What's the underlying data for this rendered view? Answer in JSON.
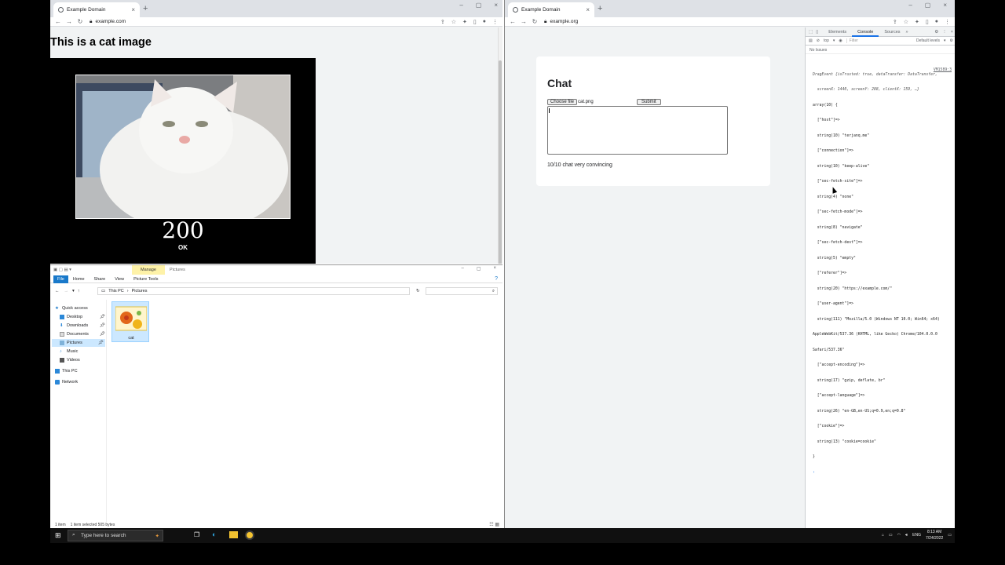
{
  "left_browser": {
    "tab_title": "Example Domain",
    "url": "example.com",
    "page_heading": "This is a cat image",
    "status_code": "200",
    "status_text": "OK"
  },
  "explorer": {
    "manage_label": "Manage",
    "folder_title": "Pictures",
    "ribbon": [
      "File",
      "Home",
      "Share",
      "View",
      "Picture Tools"
    ],
    "breadcrumb": [
      "This PC",
      "Pictures"
    ],
    "nav": [
      "Quick access",
      "Desktop",
      "Downloads",
      "Documents",
      "Pictures",
      "Music",
      "Videos",
      "This PC",
      "Network"
    ],
    "file_name": "cat",
    "status_count": "1 item",
    "status_selected": "1 item selected 505 bytes"
  },
  "right_browser": {
    "tab_title": "Example Domain",
    "url": "example.org",
    "chat_heading": "Chat",
    "choose_file": "Choose file",
    "file_name": "cat.png",
    "submit": "Submit",
    "message": "10/10 chat very convincing"
  },
  "devtools": {
    "tabs": [
      "Elements",
      "Console",
      "Sources"
    ],
    "context": "top",
    "filter_placeholder": "Filter",
    "levels": "Default levels",
    "issues": "No Issues",
    "source_link": "VM1589:3",
    "log_lines": [
      "DragEvent {isTrusted: true, dataTransfer: DataTransfer,",
      "  screenX: 1440, screenY: 288, clientX: 159, …}",
      "array(10) {",
      "  [\"host\"]=>",
      "  string(10) \"terjanq.me\"",
      "  [\"connection\"]=>",
      "  string(10) \"keep-alive\"",
      "  [\"sec-fetch-site\"]=>",
      "  string(4) \"none\"",
      "  [\"sec-fetch-mode\"]=>",
      "  string(8) \"navigate\"",
      "  [\"sec-fetch-dest\"]=>",
      "  string(5) \"empty\"",
      "  [\"referer\"]=>",
      "  string(20) \"https://example.com/\"",
      "  [\"user-agent\"]=>",
      "  string(111) \"Mozilla/5.0 (Windows NT 10.0; Win64; x64)",
      "AppleWebKit/537.36 (KHTML, like Gecko) Chrome/104.0.0.0",
      "Safari/537.36\"",
      "  [\"accept-encoding\"]=>",
      "  string(17) \"gzip, deflate, br\"",
      "  [\"accept-language\"]=>",
      "  string(26) \"en-GB,en-US;q=0.9,en;q=0.8\"",
      "  [\"cookie\"]=>",
      "  string(13) \"cookie=cookie\"",
      "}"
    ]
  },
  "taskbar": {
    "search_placeholder": "Type here to search",
    "lang": "ENG",
    "time": "8:13 AM",
    "date": "7/24/2022"
  }
}
